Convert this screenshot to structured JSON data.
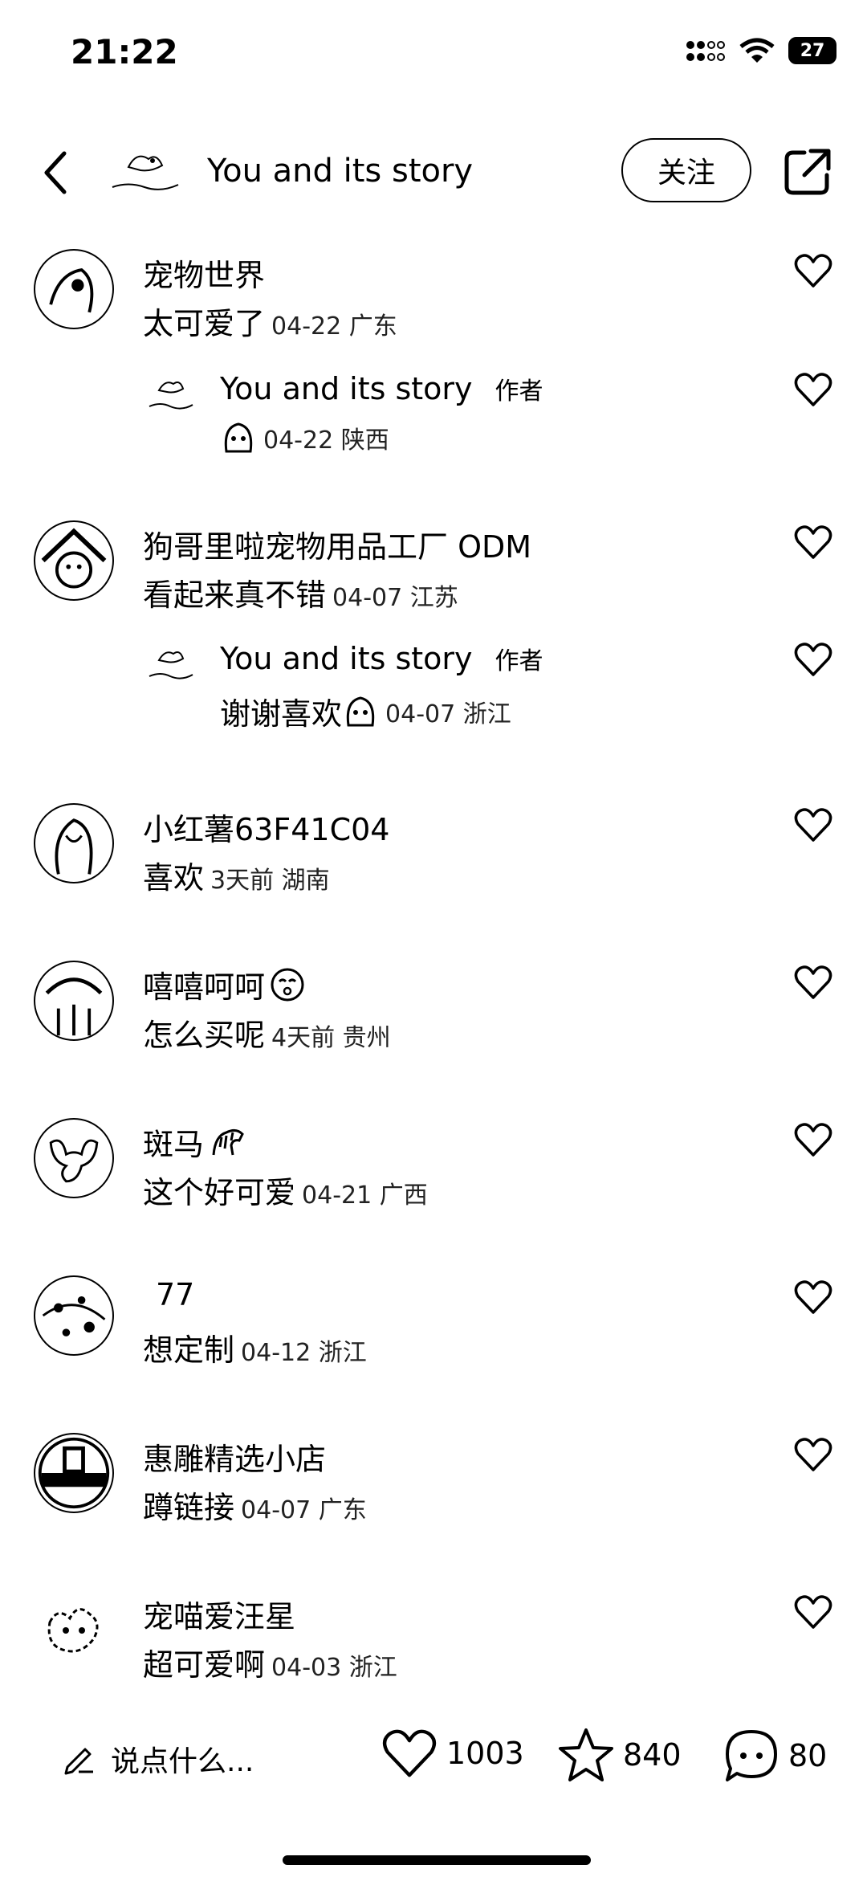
{
  "status": {
    "time": "21:22",
    "battery": "27"
  },
  "header": {
    "title": "You and its story",
    "follow_label": "关注"
  },
  "comments": [
    {
      "name": "宠物世界",
      "text": "太可爱了",
      "meta": "04-22 广东",
      "reply": {
        "name": "You and its story",
        "tag": "作者",
        "text": "",
        "meta": "04-22 陕西"
      }
    },
    {
      "name": "狗哥里啦宠物用品工厂 ODM",
      "text": "看起来真不错",
      "meta": "04-07 江苏",
      "reply": {
        "name": "You and its story",
        "tag": "作者",
        "text": "谢谢喜欢",
        "meta": "04-07 浙江"
      }
    },
    {
      "name": "小红薯63F41C04",
      "text": "喜欢",
      "meta": "3天前 湖南"
    },
    {
      "name": "嘻嘻呵呵",
      "text": "怎么买呢",
      "meta": "4天前 贵州"
    },
    {
      "name": "斑马",
      "text": "这个好可爱",
      "meta": "04-21 广西"
    },
    {
      "name": "77",
      "text": "想定制",
      "meta": "04-12 浙江"
    },
    {
      "name": "惠雕精选小店",
      "text": "蹲链接",
      "meta": "04-07 广东"
    },
    {
      "name": "宠喵爱汪星",
      "text": "超可爱啊",
      "meta": "04-03 浙江"
    }
  ],
  "bottom": {
    "input_placeholder": "说点什么...",
    "likes": "1003",
    "favorites": "840",
    "comments": "80"
  }
}
